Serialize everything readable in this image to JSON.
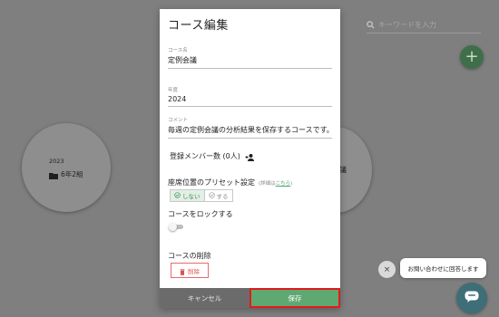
{
  "background": {
    "search_placeholder": "キーワードを入力",
    "add_button_label": "+",
    "course_card": {
      "year": "2023",
      "name": "6年2組"
    },
    "partial_card_text": "議"
  },
  "modal": {
    "title": "コース編集",
    "course_name": {
      "label": "コース名",
      "value": "定例会議"
    },
    "year": {
      "label": "年度",
      "value": "2024"
    },
    "comment": {
      "label": "コメント",
      "value": "毎週の定例会議の分析結果を保存するコースです。"
    },
    "members_label": "登録メンバー数 (0人)",
    "preset": {
      "title": "座席位置のプリセット設定",
      "hint_prefix": "(詳細は",
      "hint_link": "こちら",
      "hint_suffix": ")",
      "options": [
        "しない",
        "する"
      ],
      "selected": "しない"
    },
    "lock_label": "コースをロックする",
    "lock_enabled": false,
    "delete_section_label": "コースの削除",
    "delete_button_label": "削除",
    "cancel_label": "キャンセル",
    "save_label": "保存"
  },
  "chat": {
    "close_label": "×",
    "bubble_text": "お問い合わせに回答します"
  },
  "colors": {
    "accent_green": "#5fa872",
    "danger_red": "#d9534f",
    "highlight_border": "#e21b1b",
    "chat_fab": "#3e6e78"
  }
}
